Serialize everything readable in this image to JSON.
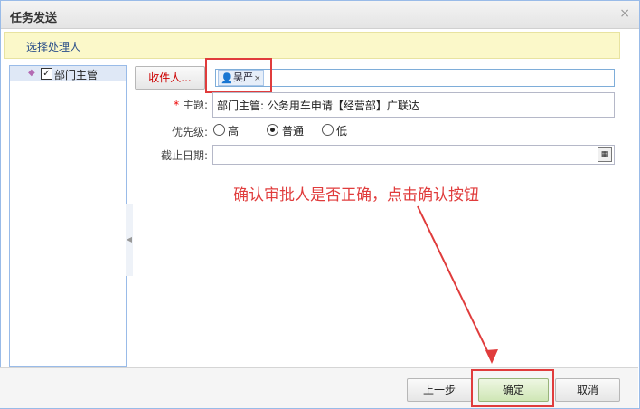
{
  "window": {
    "title": "任务发送",
    "close_glyph": "×"
  },
  "hint": {
    "text": "选择处理人"
  },
  "tree": {
    "items": [
      {
        "label": "部门主管",
        "checked": true
      }
    ]
  },
  "form": {
    "recipient_button": "收件人...",
    "recipient_chip": "吴严",
    "recipient_chip_remove": "×",
    "subject_required": "*",
    "subject_label": "主题:",
    "subject_value": "部门主管: 公务用车申请【经营部】广联达",
    "priority_label": "优先级:",
    "priority_options": [
      {
        "label": "高",
        "selected": false
      },
      {
        "label": "普通",
        "selected": true
      },
      {
        "label": "低",
        "selected": false
      }
    ],
    "deadline_label": "截止日期:",
    "deadline_value": ""
  },
  "annotation": {
    "text": "确认审批人是否正确，点击确认按钮",
    "color": "#e03c3c"
  },
  "footer": {
    "prev_label": "上一步",
    "ok_label": "确定",
    "cancel_label": "取消"
  }
}
